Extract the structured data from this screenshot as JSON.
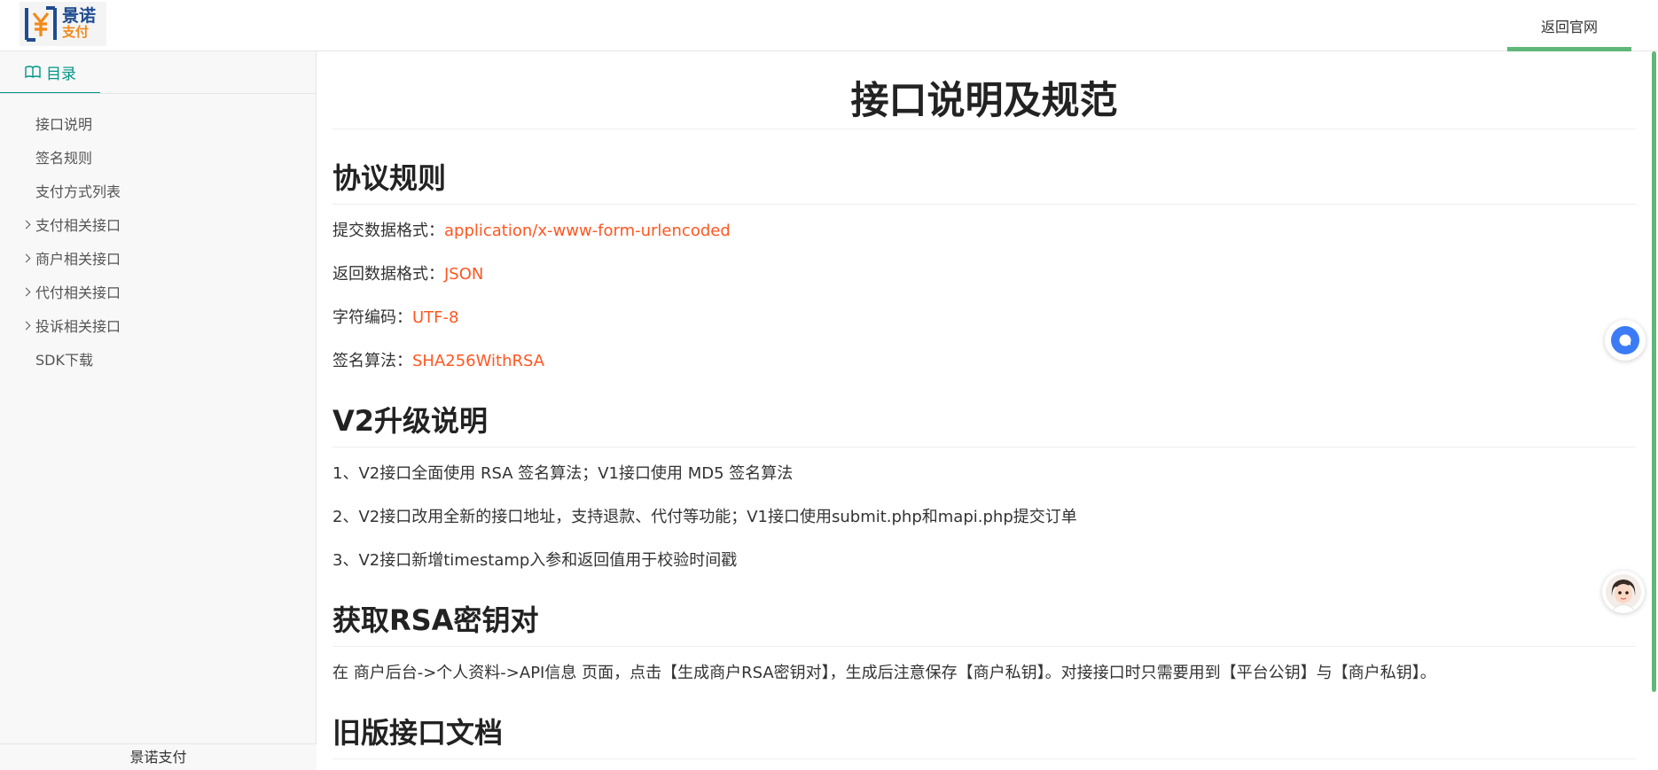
{
  "header": {
    "logo_line1": "景诺",
    "logo_line2": "支付",
    "back_link": "返回官网"
  },
  "sidebar": {
    "tab_label": "目录",
    "items": [
      {
        "label": "接口说明",
        "expandable": false
      },
      {
        "label": "签名规则",
        "expandable": false
      },
      {
        "label": "支付方式列表",
        "expandable": false
      },
      {
        "label": "支付相关接口",
        "expandable": true
      },
      {
        "label": "商户相关接口",
        "expandable": true
      },
      {
        "label": "代付相关接口",
        "expandable": true
      },
      {
        "label": "投诉相关接口",
        "expandable": true
      },
      {
        "label": "SDK下载",
        "expandable": false
      }
    ],
    "footer": "景诺支付"
  },
  "content": {
    "title": "接口说明及规范",
    "protocol": {
      "heading": "协议规则",
      "rows": [
        {
          "label": "提交数据格式：",
          "value": "application/x-www-form-urlencoded"
        },
        {
          "label": "返回数据格式：",
          "value": "JSON"
        },
        {
          "label": "字符编码：",
          "value": "UTF-8"
        },
        {
          "label": "签名算法：",
          "value": "SHA256WithRSA"
        }
      ]
    },
    "v2": {
      "heading": "V2升级说明",
      "lines": [
        "1、V2接口全面使用 RSA 签名算法；V1接口使用 MD5 签名算法",
        "2、V2接口改用全新的接口地址，支持退款、代付等功能；V1接口使用submit.php和mapi.php提交订单",
        "3、V2接口新增timestamp入参和返回值用于校验时间戳"
      ]
    },
    "rsa": {
      "heading": "获取RSA密钥对",
      "text": "在 商户后台->个人资料->API信息 页面，点击【生成商户RSA密钥对】，生成后注意保存【商户私钥】。对接接口时只需要用到【平台公钥】与【商户私钥】。"
    },
    "legacy": {
      "heading": "旧版接口文档"
    }
  },
  "colors": {
    "accent": "#009688",
    "highlight": "#ff5722",
    "indicator": "#5fb878"
  }
}
